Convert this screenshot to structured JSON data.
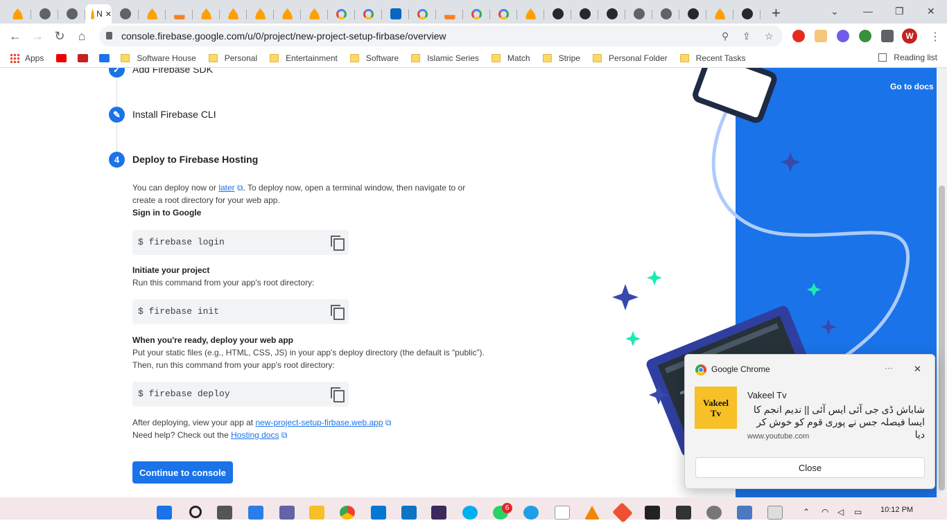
{
  "browser": {
    "tabs": [
      {
        "icon": "pma-icon"
      },
      {
        "icon": "globe-icon"
      },
      {
        "icon": "globe-icon"
      },
      {
        "icon": "firebase-icon",
        "label": "N",
        "active": true
      },
      {
        "icon": "globe-icon"
      },
      {
        "icon": "firebase-icon"
      },
      {
        "icon": "stackoverflow-icon"
      },
      {
        "icon": "firebase-icon"
      },
      {
        "icon": "firebase-icon"
      },
      {
        "icon": "firebase-icon"
      },
      {
        "icon": "firebase-icon"
      },
      {
        "icon": "firebase-icon"
      },
      {
        "icon": "google-icon"
      },
      {
        "icon": "google-icon"
      },
      {
        "icon": "linkedin-icon"
      },
      {
        "icon": "google-icon"
      },
      {
        "icon": "stackoverflow-icon"
      },
      {
        "icon": "google-icon"
      },
      {
        "icon": "google-icon"
      },
      {
        "icon": "firebase-icon"
      },
      {
        "icon": "github-icon"
      },
      {
        "icon": "github-icon"
      },
      {
        "icon": "github-icon"
      },
      {
        "icon": "globe-icon"
      },
      {
        "icon": "globe-icon"
      },
      {
        "icon": "github-icon"
      },
      {
        "icon": "firebase-icon"
      },
      {
        "icon": "github-icon"
      }
    ],
    "active_tab_label": "N",
    "new_tab": "+",
    "url": "console.firebase.google.com/u/0/project/new-project-setup-firbase/overview",
    "profile_initial": "W",
    "bookmarks": [
      "Apps",
      "Software House",
      "Personal",
      "Entertainment",
      "Software",
      "Islamic Series",
      "Match",
      "Stripe",
      "Personal Folder",
      "Recent Tasks"
    ],
    "reading_list": "Reading list"
  },
  "steps": {
    "add_sdk": "Add Firebase SDK",
    "install_cli": "Install Firebase CLI",
    "deploy_num": "4",
    "deploy_title": "Deploy to Firebase Hosting",
    "intro_1": "You can deploy now or ",
    "intro_later": "later",
    "intro_2": ". To deploy now, open a terminal window, then navigate to or",
    "intro_3": "create a root directory for your web app.",
    "sign_in": "Sign in to Google",
    "cmd_login": "$ firebase login",
    "init_title": "Initiate your project",
    "init_desc": "Run this command from your app's root directory:",
    "cmd_init": "$ firebase init",
    "ready_title": "When you're ready, deploy your web app",
    "ready_desc_1": "Put your static files (e.g., HTML, CSS, JS) in your app's deploy directory (the default is “public”).",
    "ready_desc_2": "Then, run this command from your app's root directory:",
    "cmd_deploy": "$ firebase deploy",
    "after_1": "After deploying, view your app at ",
    "after_link": "new-project-setup-firbase.web.app",
    "help_1": "Need help? Check out the ",
    "help_link": "Hosting docs",
    "continue": "Continue to console"
  },
  "sidebar": {
    "go_to_docs": "Go to docs",
    "accent": "#1a73e8"
  },
  "notification": {
    "app": "Google Chrome",
    "more": "···",
    "close_x": "✕",
    "thumb_text_1": "Vakeel",
    "thumb_text_2": "Tv",
    "title": "Vakeel Tv",
    "body": "شاباش ڈی جی آئی ایس آئی || ندیم انجم کا ایسا فیصلہ جس نے پوری قوم کو خوش کر دیا",
    "site": "www.youtube.com",
    "close_button": "Close"
  },
  "taskbar": {
    "whatsapp_badge": "6",
    "time": "10:12 PM"
  }
}
